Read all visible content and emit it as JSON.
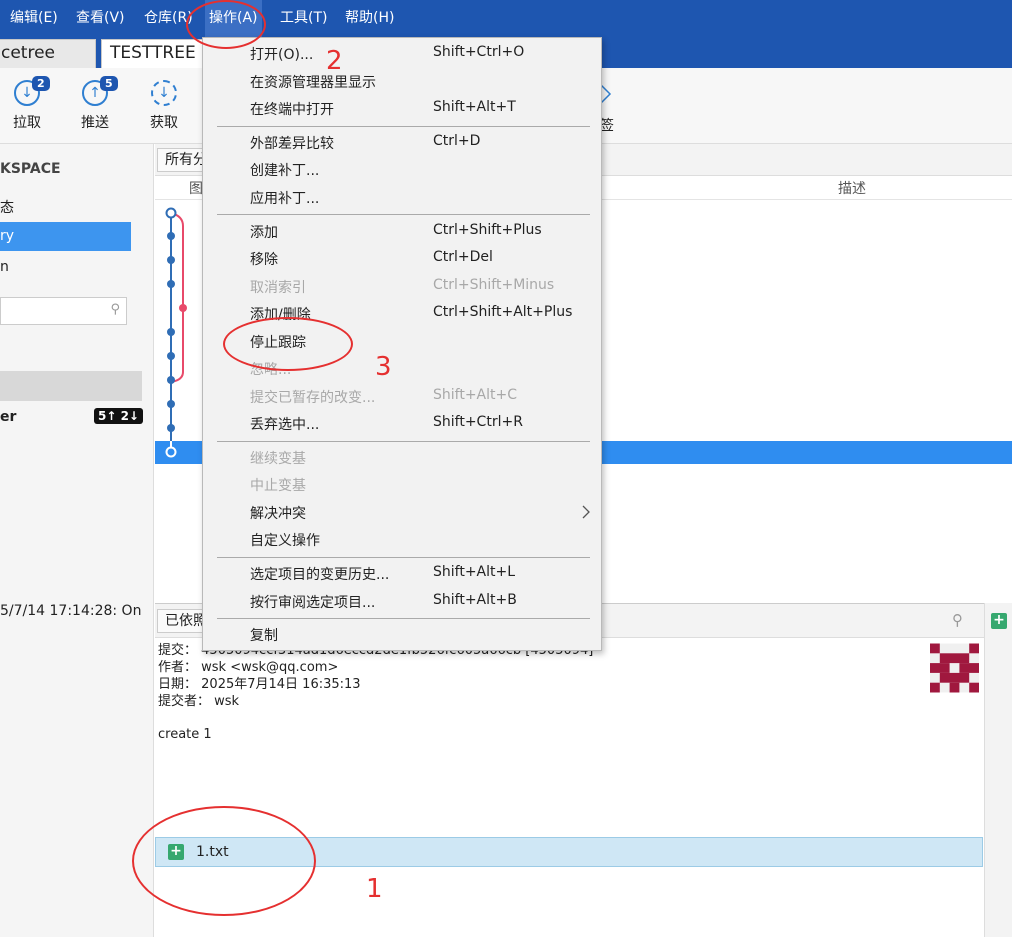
{
  "menubar": {
    "items": [
      {
        "label": "编辑(E)"
      },
      {
        "label": "查看(V)"
      },
      {
        "label": "仓库(R)"
      },
      {
        "label": "操作(A)"
      },
      {
        "label": "工具(T)"
      },
      {
        "label": "帮助(H)"
      }
    ]
  },
  "tabs": [
    {
      "label": "cetree"
    },
    {
      "label": "TESTTREE"
    }
  ],
  "toolbar": {
    "pull": {
      "label": "拉取",
      "badge": "2"
    },
    "push": {
      "label": "推送",
      "badge": "5"
    },
    "fetch": {
      "label": "获取"
    },
    "tag_fragment": "签"
  },
  "sidebar": {
    "workspace_title": "KSPACE",
    "item_status": "态",
    "item_history": "ry",
    "item_search": "n",
    "branch_name": "er",
    "branch_badge": "5↑ 2↓",
    "timestamp": "5/7/14 17:14:28: On"
  },
  "graph": {
    "filter_label": "所有分",
    "col_graph": "图",
    "col_desc": "描述"
  },
  "detail": {
    "header_label": "已依照",
    "commit_label": "提交：",
    "commit_value": "4505094ccf314ad1d6eccd2de1fb526fc605a66cb [4505094]",
    "author_label": "作者：",
    "author_value": "wsk <wsk@qq.com>",
    "date_label": "日期：",
    "date_value": "2025年7月14日 16:35:13",
    "committer_label": "提交者：",
    "committer_value": "wsk",
    "message": "create 1",
    "file_name": "1.txt"
  },
  "dropdown": {
    "items": [
      {
        "label": "打开(O)...",
        "shortcut": "Shift+Ctrl+O",
        "enabled": true
      },
      {
        "label": "在资源管理器里显示",
        "shortcut": "",
        "enabled": true
      },
      {
        "label": "在终端中打开",
        "shortcut": "Shift+Alt+T",
        "enabled": true
      },
      {
        "label": "外部差异比较",
        "shortcut": "Ctrl+D",
        "enabled": true
      },
      {
        "label": "创建补丁...",
        "shortcut": "",
        "enabled": true
      },
      {
        "label": "应用补丁...",
        "shortcut": "",
        "enabled": true
      },
      {
        "label": "添加",
        "shortcut": "Ctrl+Shift+Plus",
        "enabled": true
      },
      {
        "label": "移除",
        "shortcut": "Ctrl+Del",
        "enabled": true
      },
      {
        "label": "取消索引",
        "shortcut": "Ctrl+Shift+Minus",
        "enabled": false
      },
      {
        "label": "添加/删除",
        "shortcut": "Ctrl+Shift+Alt+Plus",
        "enabled": true
      },
      {
        "label": "停止跟踪",
        "shortcut": "",
        "enabled": true
      },
      {
        "label": "忽略...",
        "shortcut": "",
        "enabled": false
      },
      {
        "label": "提交已暂存的改变...",
        "shortcut": "Shift+Alt+C",
        "enabled": false
      },
      {
        "label": "丢弃选中...",
        "shortcut": "Shift+Ctrl+R",
        "enabled": true
      },
      {
        "label": "继续变基",
        "shortcut": "",
        "enabled": false
      },
      {
        "label": "中止变基",
        "shortcut": "",
        "enabled": false
      },
      {
        "label": "解决冲突",
        "shortcut": "",
        "enabled": true
      },
      {
        "label": "自定义操作",
        "shortcut": "",
        "enabled": true
      },
      {
        "label": "选定项目的变更历史...",
        "shortcut": "Shift+Alt+L",
        "enabled": true
      },
      {
        "label": "按行审阅选定项目...",
        "shortcut": "Shift+Alt+B",
        "enabled": true
      },
      {
        "label": "复制",
        "shortcut": "",
        "enabled": true
      }
    ]
  },
  "annotations": {
    "n1": "1",
    "n2": "2",
    "n3": "3"
  },
  "colors": {
    "menubar_bg": "#1e56b0",
    "selection": "#2f8df0",
    "graph_node": "#2f6db5",
    "graph_branch": "#e84a6a",
    "annotation_red": "#e53030"
  }
}
